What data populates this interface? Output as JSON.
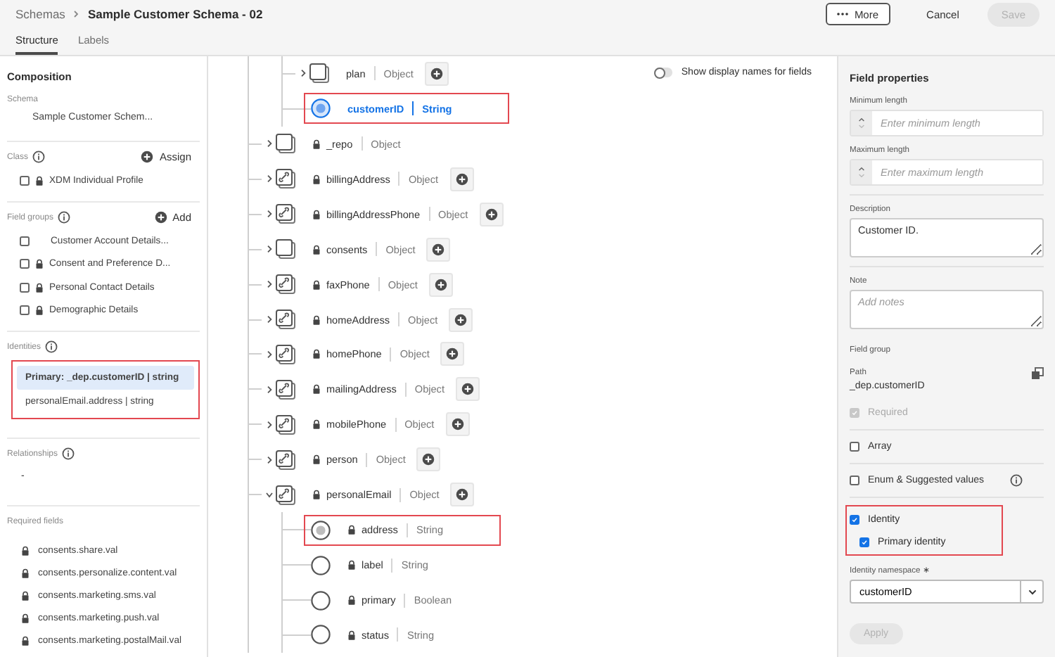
{
  "header": {
    "breadcrumb": {
      "parent": "Schemas",
      "current": "Sample Customer Schema - 02"
    },
    "buttons": [
      {
        "kind": "more",
        "label": "More",
        "disabled": false
      },
      {
        "kind": "quiet",
        "label": "Cancel",
        "disabled": false
      },
      {
        "kind": "primary",
        "label": "Save",
        "disabled": true
      }
    ],
    "tabs": [
      {
        "label": "Structure",
        "selected": true
      },
      {
        "label": "Labels",
        "selected": false
      }
    ]
  },
  "composition": {
    "title": "Composition",
    "schema": {
      "label": "Schema",
      "value": "Sample Customer Schem..."
    },
    "class": {
      "label": "Class",
      "action": "Assign",
      "items": [
        {
          "label": "XDM Individual Profile",
          "locked": true,
          "checked": false
        }
      ]
    },
    "field_groups": {
      "label": "Field groups",
      "action": "Add",
      "items": [
        {
          "label": "Customer Account Details...",
          "locked": false,
          "checked": false
        },
        {
          "label": "Consent and Preference D...",
          "locked": true,
          "checked": false
        },
        {
          "label": "Personal Contact Details",
          "locked": true,
          "checked": false
        },
        {
          "label": "Demographic Details",
          "locked": true,
          "checked": false
        }
      ]
    },
    "identities": {
      "label": "Identities",
      "highlighted": true,
      "items": [
        {
          "text": "Primary: _dep.customerID | string",
          "selected": true
        },
        {
          "text": "personalEmail.address | string",
          "selected": false
        }
      ]
    },
    "relationships": {
      "label": "Relationships",
      "value": "-"
    },
    "required_fields": {
      "label": "Required fields",
      "items": [
        "consents.share.val",
        "consents.personalize.content.val",
        "consents.marketing.sms.val",
        "consents.marketing.push.val",
        "consents.marketing.postalMail.val"
      ]
    }
  },
  "tree": {
    "toggle": {
      "label": "Show display names for fields",
      "on": false
    },
    "continued_children": [
      {
        "name": "plan",
        "type": "Object",
        "kind": "object",
        "locked": false,
        "expanded": false,
        "addable": true,
        "selected": false,
        "highlighted": false
      },
      {
        "name": "customerID",
        "type": "String",
        "kind": "field",
        "locked": false,
        "selected": true,
        "identity": true,
        "highlighted": true
      }
    ],
    "nodes": [
      {
        "name": "_repo",
        "type": "Object",
        "kind": "object",
        "locked": true,
        "expanded": false,
        "addable": false,
        "selected": false,
        "highlighted": false
      },
      {
        "name": "billingAddress",
        "type": "Object",
        "kind": "reference",
        "locked": true,
        "expanded": false,
        "addable": true,
        "selected": false,
        "highlighted": false
      },
      {
        "name": "billingAddressPhone",
        "type": "Object",
        "kind": "reference",
        "locked": true,
        "expanded": false,
        "addable": true,
        "selected": false,
        "highlighted": false
      },
      {
        "name": "consents",
        "type": "Object",
        "kind": "object",
        "locked": true,
        "expanded": false,
        "addable": true,
        "selected": false,
        "highlighted": false
      },
      {
        "name": "faxPhone",
        "type": "Object",
        "kind": "reference",
        "locked": true,
        "expanded": false,
        "addable": true,
        "selected": false,
        "highlighted": false
      },
      {
        "name": "homeAddress",
        "type": "Object",
        "kind": "reference",
        "locked": true,
        "expanded": false,
        "addable": true,
        "selected": false,
        "highlighted": false
      },
      {
        "name": "homePhone",
        "type": "Object",
        "kind": "reference",
        "locked": true,
        "expanded": false,
        "addable": true,
        "selected": false,
        "highlighted": false
      },
      {
        "name": "mailingAddress",
        "type": "Object",
        "kind": "reference",
        "locked": true,
        "expanded": false,
        "addable": true,
        "selected": false,
        "highlighted": false
      },
      {
        "name": "mobilePhone",
        "type": "Object",
        "kind": "reference",
        "locked": true,
        "expanded": false,
        "addable": true,
        "selected": false,
        "highlighted": false
      },
      {
        "name": "person",
        "type": "Object",
        "kind": "reference",
        "locked": true,
        "expanded": false,
        "addable": true,
        "selected": false,
        "highlighted": false
      },
      {
        "name": "personalEmail",
        "type": "Object",
        "kind": "reference",
        "locked": true,
        "expanded": true,
        "addable": true,
        "selected": false,
        "highlighted": false,
        "children": [
          {
            "name": "address",
            "type": "String",
            "kind": "field",
            "locked": true,
            "selected": false,
            "identity": true,
            "highlighted": true
          },
          {
            "name": "label",
            "type": "String",
            "kind": "field",
            "locked": true,
            "selected": false,
            "identity": false,
            "highlighted": false
          },
          {
            "name": "primary",
            "type": "Boolean",
            "kind": "field",
            "locked": true,
            "selected": false,
            "identity": false,
            "highlighted": false
          },
          {
            "name": "status",
            "type": "String",
            "kind": "field",
            "locked": true,
            "selected": false,
            "identity": false,
            "highlighted": false
          }
        ]
      }
    ]
  },
  "field_properties": {
    "title": "Field properties",
    "minimum_length": {
      "label": "Minimum length",
      "placeholder": "Enter minimum length"
    },
    "maximum_length": {
      "label": "Maximum length",
      "placeholder": "Enter maximum length"
    },
    "description": {
      "label": "Description",
      "value": "Customer ID."
    },
    "note": {
      "label": "Note",
      "placeholder": "Add notes"
    },
    "field_group": {
      "label": "Field group"
    },
    "path": {
      "label": "Path",
      "value": "_dep.customerID"
    },
    "options": [
      {
        "label": "Required",
        "checked": true,
        "disabled": true,
        "info": false
      },
      {
        "label": "Array",
        "checked": false,
        "disabled": false,
        "info": false
      },
      {
        "label": "Enum & Suggested values",
        "checked": false,
        "disabled": false,
        "info": true
      }
    ],
    "identity": {
      "highlighted": true,
      "label": "Identity",
      "checked": true,
      "primary": {
        "label": "Primary identity",
        "checked": true
      }
    },
    "identity_namespace": {
      "label": "Identity namespace",
      "required_mark": "∗",
      "value": "customerID"
    },
    "apply": {
      "label": "Apply",
      "disabled": true
    }
  }
}
